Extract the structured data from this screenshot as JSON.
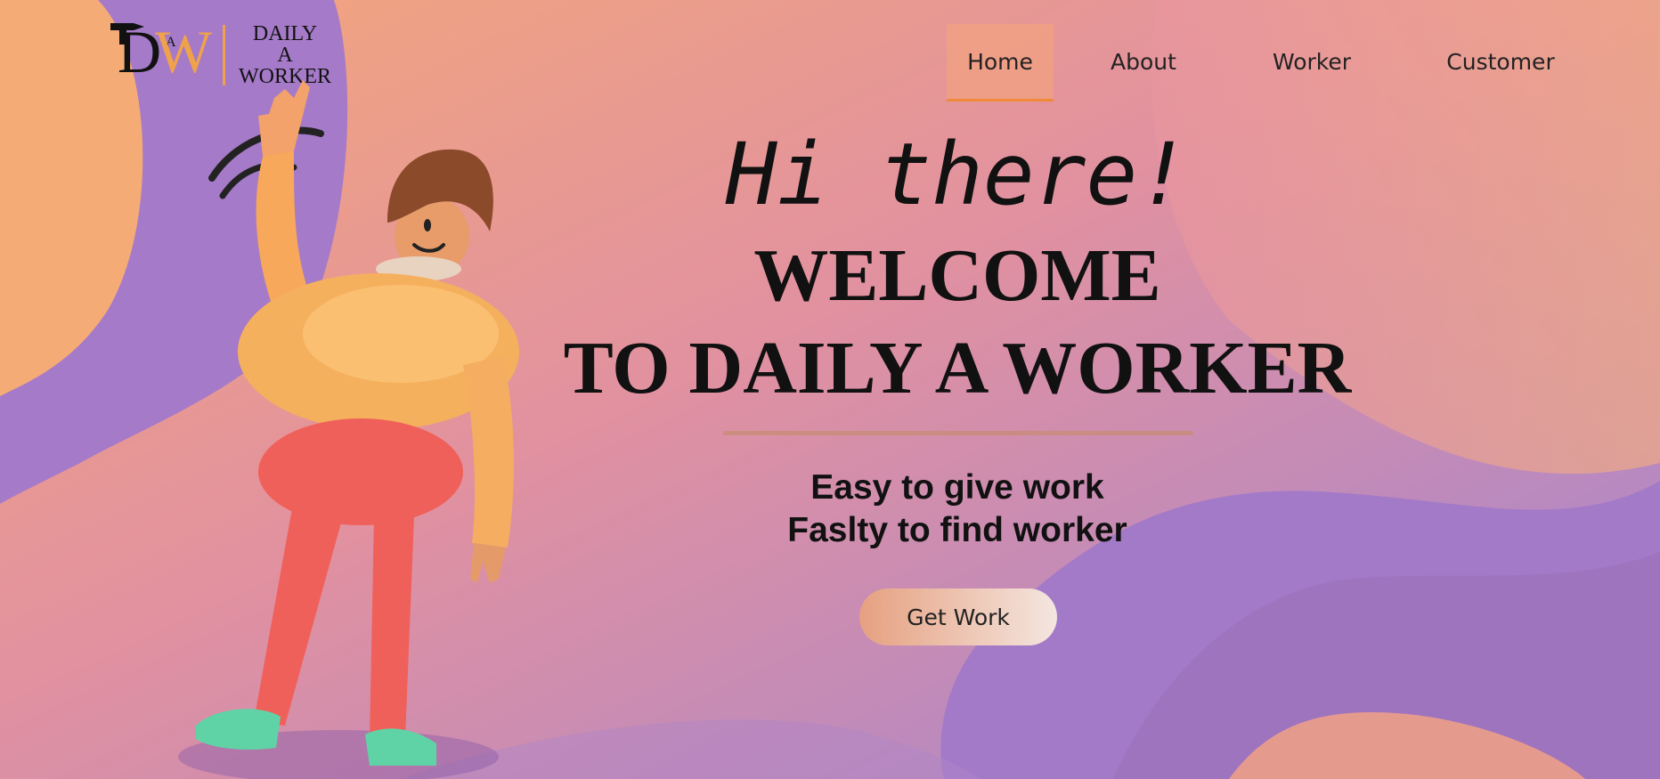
{
  "logo": {
    "letters": [
      "D",
      "A",
      "W"
    ],
    "text_lines": [
      "DAILY",
      "A",
      "WORKER"
    ],
    "icon": "hammer-icon"
  },
  "nav": {
    "items": [
      {
        "label": "Home",
        "active": true
      },
      {
        "label": "About",
        "active": false
      },
      {
        "label": "Worker",
        "active": false
      },
      {
        "label": "Customer",
        "active": false
      }
    ]
  },
  "hero": {
    "greeting": "Hi there!",
    "title_line1": "WELCOME",
    "title_line2": "TO DAILY A WORKER",
    "tagline1": "Easy to give work",
    "tagline2": "Faslty to find worker",
    "cta_label": "Get Work"
  },
  "colors": {
    "accent_orange": "#f0a24a",
    "purple_blob": "#a57ac8",
    "bg_pink": "#e89a8c"
  }
}
